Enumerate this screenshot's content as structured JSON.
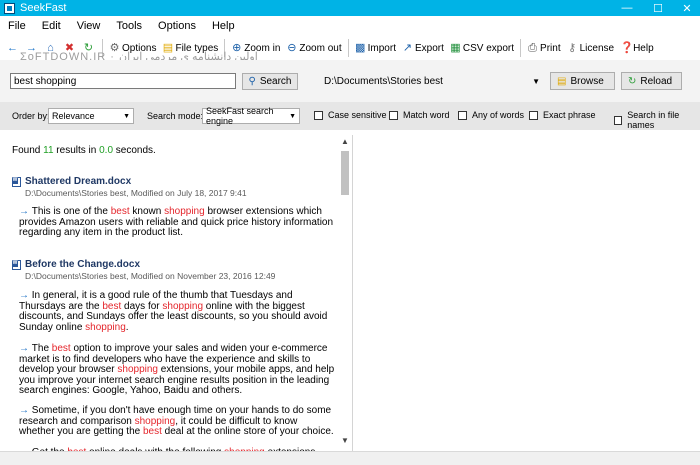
{
  "window": {
    "title": "SeekFast"
  },
  "menu": [
    "File",
    "Edit",
    "View",
    "Tools",
    "Options",
    "Help"
  ],
  "toolbar": {
    "watermark": "ΣoFTDOWN.IR · اولین دانشنامه ی مردمی ایران",
    "options": "Options",
    "file_types": "File types",
    "zoom_in": "Zoom in",
    "zoom_out": "Zoom out",
    "import": "Import",
    "export": "Export",
    "csv_export": "CSV export",
    "print": "Print",
    "license": "License",
    "help": "Help"
  },
  "search": {
    "query": "best shopping",
    "search_label": "Search",
    "path": "D:\\Documents\\Stories best",
    "browse_label": "Browse",
    "reload_label": "Reload"
  },
  "options": {
    "order_by_label": "Order by:",
    "order_by_value": "Relevance",
    "mode_label": "Search mode:",
    "mode_value": "SeekFast search engine",
    "case_sensitive": "Case sensitive",
    "match_word": "Match word",
    "any_of_words": "Any of words",
    "exact_phrase": "Exact phrase",
    "search_in_file_names": "Search in file names"
  },
  "results": {
    "found_prefix": "Found ",
    "count": "11",
    "found_mid": " results in ",
    "seconds": "0.0",
    "found_suffix": " seconds.",
    "items": [
      {
        "title": "Shattered Dream.docx",
        "meta": "D:\\Documents\\Stories best, Modified on July 18, 2017 9:41",
        "snippets": [
          [
            [
              "arrow",
              "→ "
            ],
            [
              "t",
              "This is one of the "
            ],
            [
              "hl",
              "best"
            ],
            [
              "t",
              " known "
            ],
            [
              "hl",
              "shopping"
            ],
            [
              "t",
              " browser extensions which provides Amazon users with reliable and quick price history information regarding any item in the product list."
            ]
          ]
        ]
      },
      {
        "title": "Before the Change.docx",
        "meta": "D:\\Documents\\Stories best, Modified on November 23, 2016 12:49",
        "snippets": [
          [
            [
              "arrow",
              "→ "
            ],
            [
              "t",
              "In general, it is a good rule of the thumb that Tuesdays and Thursdays are the "
            ],
            [
              "hl",
              "best"
            ],
            [
              "t",
              " days for "
            ],
            [
              "hl",
              "shopping"
            ],
            [
              "t",
              " online with the biggest discounts, and Sundays offer the least discounts, so you should avoid Sunday online "
            ],
            [
              "hl",
              "shopping"
            ],
            [
              "t",
              "."
            ]
          ],
          [
            [
              "arrow",
              "→ "
            ],
            [
              "t",
              "The "
            ],
            [
              "hl",
              "best"
            ],
            [
              "t",
              " option to improve your sales and widen your e-commerce market is to find developers who have the experience and skills to develop your browser "
            ],
            [
              "hl",
              "shopping"
            ],
            [
              "t",
              " extensions, your mobile apps, and help you improve your internet search engine results position in the leading search engines: Google, Yahoo, Baidu and others."
            ]
          ],
          [
            [
              "arrow",
              "→ "
            ],
            [
              "t",
              "Sometime, if you don't have enough time on your hands to do some research and comparison "
            ],
            [
              "hl",
              "shopping"
            ],
            [
              "t",
              ", it could be difficult to know whether you are getting the "
            ],
            [
              "hl",
              "best"
            ],
            [
              "t",
              " deal at the online store of your choice."
            ]
          ],
          [
            [
              "arrow",
              "→ "
            ],
            [
              "t",
              "Get the "
            ],
            [
              "hl",
              "best"
            ],
            [
              "t",
              " online deals with the following "
            ],
            [
              "hl",
              "shopping"
            ],
            [
              "t",
              " extensions"
            ]
          ]
        ]
      }
    ]
  }
}
